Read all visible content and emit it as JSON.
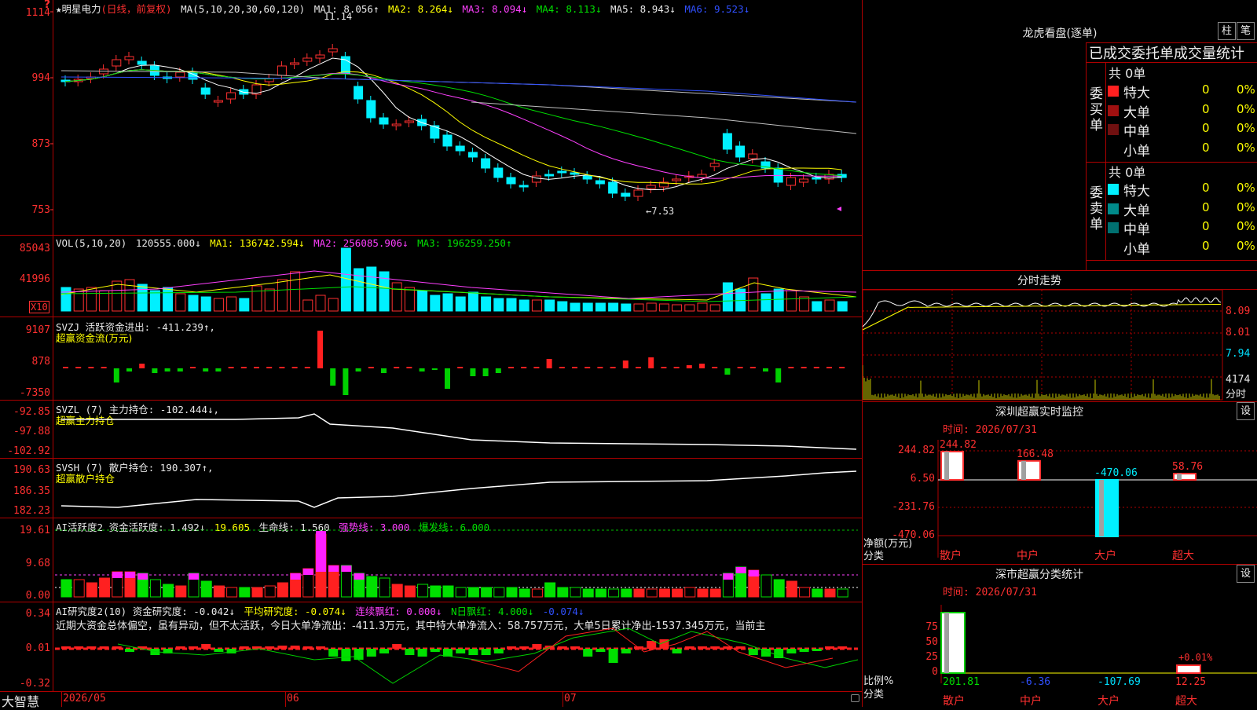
{
  "app": {
    "logo": "大智慧",
    "marker": "?"
  },
  "main": {
    "stock_title": "★明星电力",
    "stock_mode": "(日线，前复权)",
    "ma_legend": {
      "label": "MA(5,10,20,30,60,120)",
      "ma1": "MA1: 8.056↑",
      "ma2": "MA2: 8.264↓",
      "ma3": "MA3: 8.094↓",
      "ma4": "MA4: 8.113↓",
      "ma5": "MA5: 8.943↓",
      "ma6": "MA6: 9.523↓"
    },
    "price_axis": [
      "1114",
      "994",
      "873",
      "753"
    ],
    "high_label": "11.14",
    "low_label": "←7.53",
    "date_axis": [
      "2026/05",
      "06",
      "07"
    ]
  },
  "vol_panel": {
    "legend": [
      "VOL(5,10,20)",
      "120555.000↓",
      "MA1: 136742.594↓",
      "MA2: 256085.906↓",
      "MA3: 196259.250↑"
    ],
    "axis": [
      "85043",
      "41996"
    ],
    "unit": "X10"
  },
  "svzj_panel": {
    "legend": "SVZJ  活跃资金进出: -411.239↑,",
    "subtitle": "超赢资金流(万元)",
    "axis": [
      "9107",
      "878",
      "-7350"
    ]
  },
  "svzl_panel": {
    "legend": "SVZL (7) 主力持仓: -102.444↓,",
    "subtitle": "超赢主力持仓",
    "axis": [
      "-92.85",
      "-97.88",
      "-102.92"
    ]
  },
  "svsh_panel": {
    "legend": "SVSH (7) 散户持仓: 190.307↑,",
    "subtitle": "超赢散户持仓",
    "axis": [
      "190.63",
      "186.35",
      "182.23"
    ]
  },
  "ai_active_panel": {
    "legend": [
      "AI活跃度2 资金活跃度: 1.492↓",
      "19.605",
      "生命线: 1.560",
      "强势线: 3.000",
      "爆发线: 6.000"
    ],
    "axis": [
      "19.61",
      "9.68",
      "0.00"
    ]
  },
  "ai_research_panel": {
    "legend": [
      "AI研究度2(10) 资金研究度: -0.042↓",
      "平均研究度: -0.074↓",
      "连续飘红: 0.000↓",
      "N日飘红: 4.000↓",
      "-0.074↓"
    ],
    "commentary": "近期大资金总体偏空，虽有异动，但不太活跃，今日大单净流出：-411.3万元，其中特大单净流入：58.757万元，大单5日累计净出-1537.345万元，当前主",
    "axis": [
      "0.34",
      "0.01",
      "-0.32"
    ]
  },
  "right": {
    "dragon_tiger": {
      "title": "龙虎看盘(逐单)",
      "btn_pillar": "柱",
      "btn_pen": "笔",
      "header": "已成交委托单成交量统计",
      "buy_label": "委买单",
      "sell_label": "委卖单",
      "buy_total": "共 0单",
      "sell_total": "共 0单",
      "buy_rows": [
        {
          "name": "特大",
          "count": "0",
          "pct": "0%",
          "color": "#ff2020"
        },
        {
          "name": "大单",
          "count": "0",
          "pct": "0%",
          "color": "#a01010"
        },
        {
          "name": "中单",
          "count": "0",
          "pct": "0%",
          "color": "#701010"
        },
        {
          "name": "小单",
          "count": "0",
          "pct": "0%",
          "color": ""
        }
      ],
      "sell_rows": [
        {
          "name": "特大",
          "count": "0",
          "pct": "0%",
          "color": "#00f0ff"
        },
        {
          "name": "大单",
          "count": "0",
          "pct": "0%",
          "color": "#008a8a"
        },
        {
          "name": "中单",
          "count": "0",
          "pct": "0%",
          "color": "#007070"
        },
        {
          "name": "小单",
          "count": "0",
          "pct": "0%",
          "color": ""
        }
      ]
    },
    "intraday": {
      "title": "分时走势",
      "axis": [
        "8.09",
        "8.01",
        "7.94"
      ],
      "vol_label": "4174",
      "vol_unit": "分时"
    },
    "sz_monitor": {
      "title": "深圳超赢实时监控",
      "settings": "设",
      "time": "时间: 2026/07/31",
      "axis": [
        "244.82",
        "6.50",
        "-231.76",
        "-470.06"
      ],
      "axis_title_1": "净额(万元)",
      "axis_title_2": "分类",
      "categories": [
        "散户",
        "中户",
        "大户",
        "超大"
      ],
      "values": [
        244.82,
        166.48,
        -470.06,
        58.76
      ],
      "value_labels": [
        "244.82",
        "166.48",
        "-470.06",
        "58.76"
      ]
    },
    "sz_classify": {
      "title": "深市超赢分类统计",
      "settings": "设",
      "time": "时间: 2026/07/31",
      "axis": [
        "75",
        "50",
        "25",
        "0"
      ],
      "axis_title_1": "比例%",
      "axis_title_2": "分类",
      "categories": [
        "散户",
        "中户",
        "大户",
        "超大"
      ],
      "value_labels": [
        "201.81",
        "-6.36",
        "-107.69",
        "12.25"
      ],
      "top_label": "+0.01%"
    }
  }
}
